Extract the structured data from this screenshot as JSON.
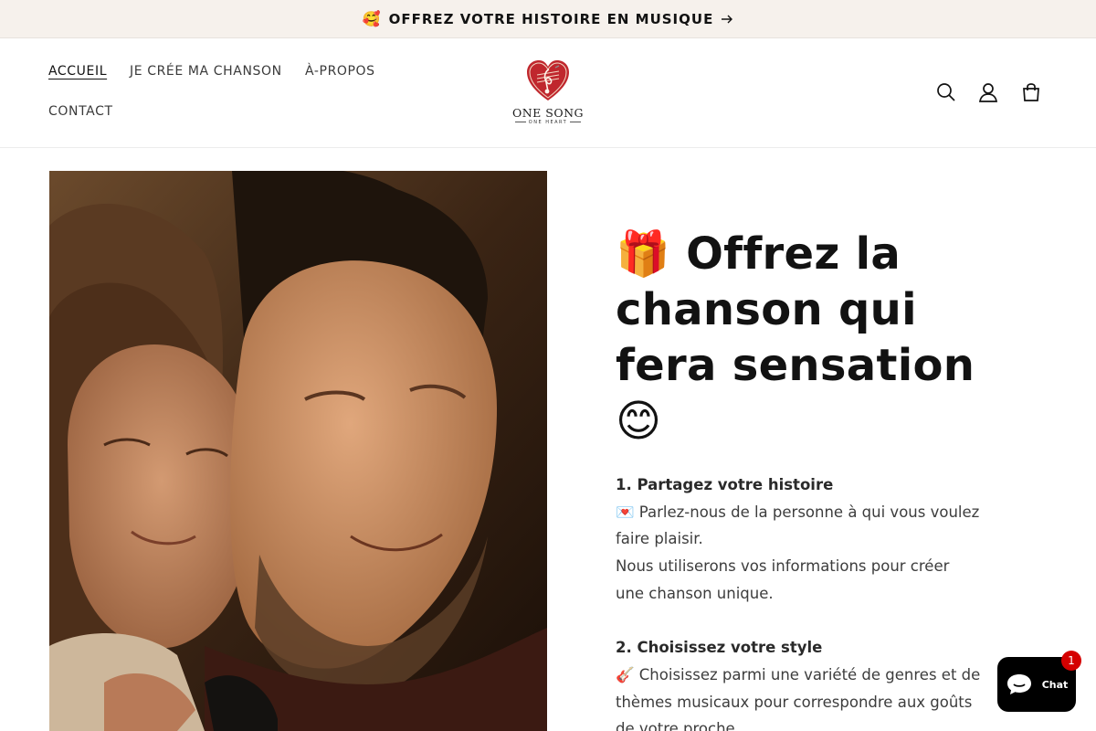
{
  "announcement": {
    "emoji": "🥰",
    "text": "OFFREZ VOTRE HISTOIRE EN MUSIQUE",
    "arrow_icon": "arrow-right-icon"
  },
  "nav": {
    "items": [
      {
        "label": "ACCUEIL",
        "active": true
      },
      {
        "label": "JE CRÉE MA CHANSON",
        "active": false
      },
      {
        "label": "À-PROPOS",
        "active": false
      },
      {
        "label": "CONTACT",
        "active": false
      }
    ]
  },
  "logo": {
    "name": "ONE SONG",
    "tagline": "ONE HEART"
  },
  "header_icons": [
    "search-icon",
    "account-icon",
    "cart-icon"
  ],
  "hero": {
    "title": "🎁 Offrez la chanson qui fera sensation 😊",
    "steps": [
      {
        "title": "1. Partagez votre histoire",
        "lines": [
          "💌 Parlez-nous de la personne à qui vous voulez faire plaisir.",
          "Nous utiliserons vos informations pour créer une chanson unique."
        ]
      },
      {
        "title": "2. Choisissez votre style",
        "lines": [
          "🎸 Choisissez parmi une variété de genres et de thèmes musicaux pour correspondre aux goûts de votre proche."
        ]
      }
    ]
  },
  "chat": {
    "label": "Chat",
    "badge": "1"
  },
  "colors": {
    "announcement_bg": "#f6f1ec",
    "text": "#121212",
    "chat_bg": "#000000",
    "badge": "#d50000",
    "logo_red": "#c0272d"
  }
}
